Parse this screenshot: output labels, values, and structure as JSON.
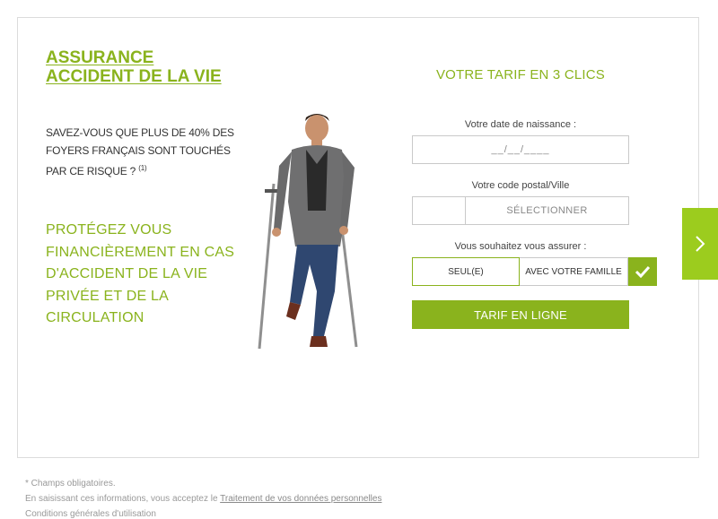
{
  "hero": {
    "title_line1": "ASSURANCE",
    "title_line2": "ACCIDENT DE LA VIE",
    "stat_text": "SAVEZ-VOUS QUE PLUS DE 40% DES FOYERS FRANÇAIS SONT TOUCHÉS PAR CE RISQUE ?",
    "stat_ref": "(1)",
    "protect_text": "PROTÉGEZ VOUS FINANCIÈREMENT EN CAS D'ACCIDENT DE LA VIE PRIVÉE ET DE LA CIRCULATION"
  },
  "form": {
    "title": "VOTRE TARIF EN 3 CLICS",
    "dob_label": "Votre date de naissance :",
    "dob_placeholder": "__/__/____",
    "postal_label": "Votre code postal/Ville",
    "postal_value": "",
    "city_placeholder": "SÉLECTIONNER",
    "insure_label": "Vous souhaitez vous assurer :",
    "option_alone": "SEUL(E)",
    "option_family": "AVEC VOTRE FAMILLE",
    "submit_label": "TARIF EN LIGNE"
  },
  "footer": {
    "required_note": "* Champs obligatoires.",
    "consent_prefix": "En saisissant ces informations, vous acceptez le",
    "consent_link": "Traitement de vos données personnelles",
    "conditions_partial": "Conditions générales d'utilisation"
  },
  "icons": {
    "check": "check-icon",
    "next": "chevron-right-icon"
  },
  "colors": {
    "accent": "#8ab31d",
    "side_button": "#9ccc1e"
  }
}
